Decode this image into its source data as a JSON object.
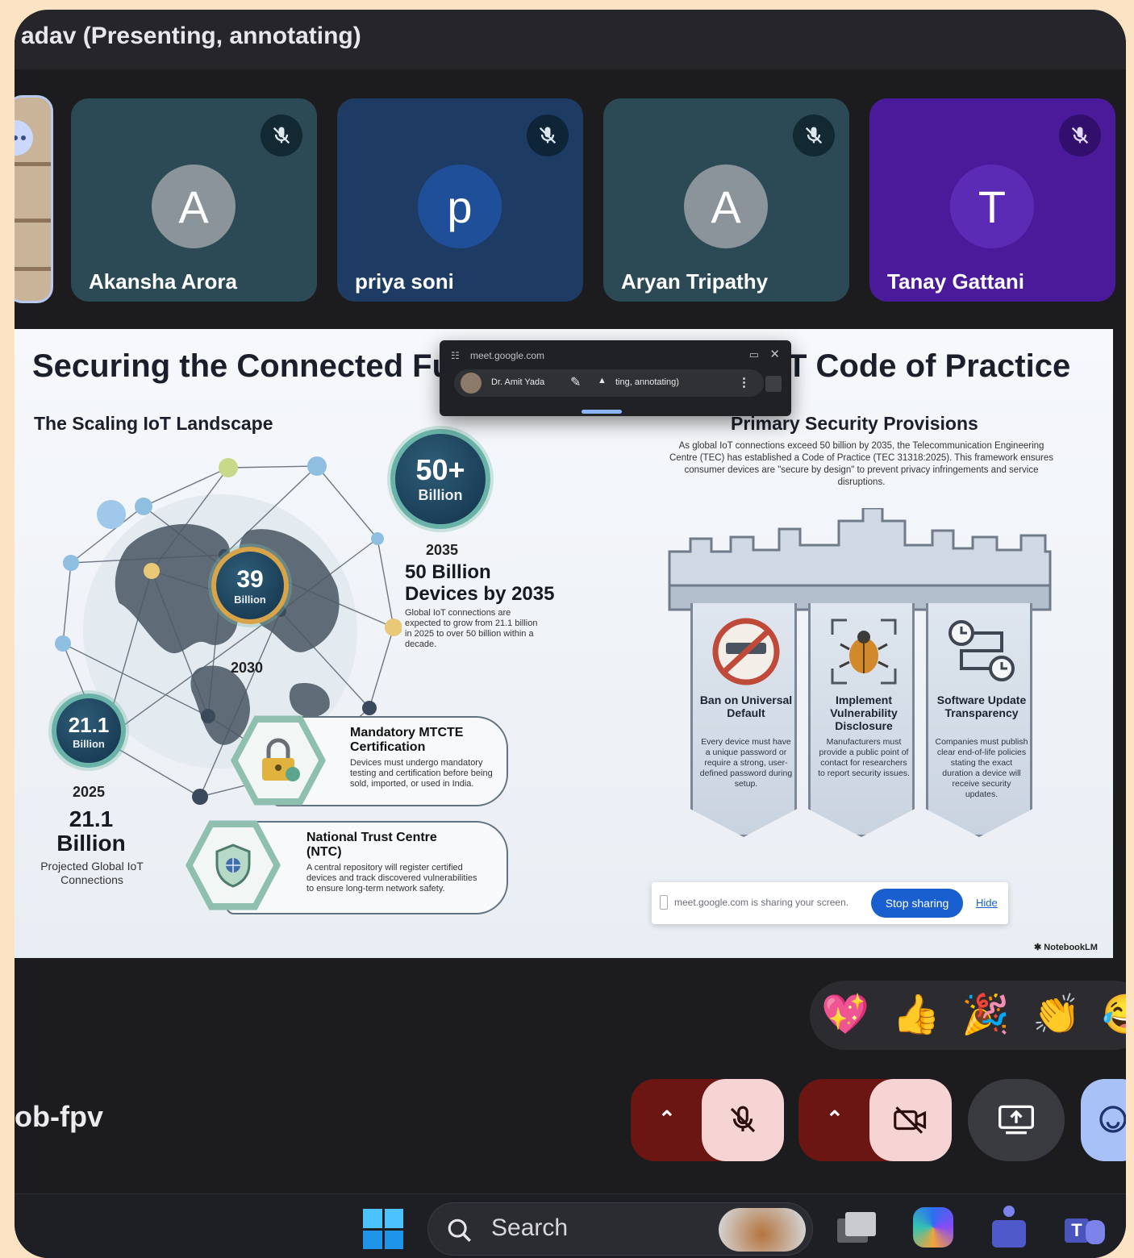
{
  "window": {
    "title": "adav (Presenting, annotating)"
  },
  "participants": [
    {
      "initial": "A",
      "name": "Akansha Arora",
      "bg": "#2c4a56",
      "avatar_bg": "#8a949a"
    },
    {
      "initial": "p",
      "name": "priya soni",
      "bg": "#1e3b63",
      "avatar_bg": "#1f4f98"
    },
    {
      "initial": "A",
      "name": "Aryan Tripathy",
      "bg": "#2c4a56",
      "avatar_bg": "#8a949a"
    },
    {
      "initial": "T",
      "name": "Tanay Gattani",
      "bg": "#4a1a9a",
      "avatar_bg": "#5b2bb6"
    }
  ],
  "slide": {
    "title_left": "Securing the Connected Fu",
    "title_right": "T Code of Practice",
    "left_heading": "The Scaling IoT Landscape",
    "right_heading": "Primary Security Provisions",
    "intro": "As global IoT connections exceed 50 billion by 2035, the Telecommunication Engineering Centre (TEC) has established a Code of Practice (TEC 31318:2025). This framework ensures consumer devices are \"secure by design\" to prevent privacy infringements and service disruptions.",
    "badges": [
      {
        "value": "50+",
        "unit": "Billion",
        "year": "2035"
      },
      {
        "value": "39",
        "unit": "Billion",
        "year": "2030"
      },
      {
        "value": "21.1",
        "unit": "Billion",
        "year": "2025"
      }
    ],
    "stat_2035": {
      "headline": "50 Billion Devices by 2035",
      "desc": "Global IoT connections are expected to grow from 21.1 billion in 2025 to over 50 billion within a decade."
    },
    "stat_2025": {
      "value": "21.1",
      "unit": "Billion",
      "desc": "Projected Global IoT Connections"
    },
    "cards": [
      {
        "title": "Mandatory MTCTE Certification",
        "desc": "Devices must undergo mandatory testing and certification before being sold, imported, or used in India."
      },
      {
        "title": "National Trust Centre (NTC)",
        "desc": "A central repository will register certified devices and track discovered vulnerabilities to ensure long-term network safety."
      }
    ],
    "pillars": [
      {
        "title": "Ban on Universal Default",
        "desc": "Every device must have a unique password or require a strong, user-defined password during setup."
      },
      {
        "title": "Implement Vulnerability Disclosure",
        "desc": "Manufacturers must provide a public point of contact for researchers to report security issues."
      },
      {
        "title": "Software Update Transparency",
        "desc": "Companies must publish clear end-of-life policies stating the exact duration a device will receive security updates."
      }
    ],
    "watermark": "NotebookLM"
  },
  "popup": {
    "url": "meet.google.com",
    "presenter": "Dr. Amit Yada",
    "status": "ting, annotating)"
  },
  "share_bar": {
    "text": "meet.google.com is sharing your screen.",
    "stop_label": "Stop sharing",
    "hide_label": "Hide"
  },
  "reactions": [
    "💖",
    "👍",
    "🎉",
    "👏",
    "😂"
  ],
  "meeting_code": "ob-fpv",
  "taskbar": {
    "search_placeholder": "Search"
  },
  "colors": {
    "danger_dark": "#6b1612",
    "danger_light": "#f6d4d4",
    "accent_blue": "#1a5fd0",
    "ctrl_grey": "#3a3b40",
    "ctrl_light_blue": "#a8c2f8"
  }
}
